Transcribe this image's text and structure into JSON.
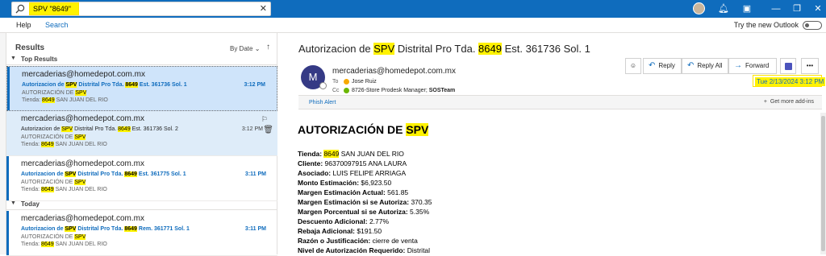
{
  "titlebar": {
    "search_value": "SPV \"8649\"",
    "icons": [
      "search-icon",
      "clear-icon",
      "avatar",
      "bell-icon",
      "settings-icon",
      "minimize-icon",
      "restore-icon",
      "close-icon"
    ],
    "color": "#0f6cbd"
  },
  "ribbon": {
    "tabs": [
      "Help",
      "Search"
    ],
    "new_outlook_label": "Try the new Outlook"
  },
  "list": {
    "title": "Results",
    "sort_label": "By Date",
    "groups": [
      {
        "label": "Top Results"
      },
      {
        "label": "Today"
      }
    ],
    "items": [
      {
        "from": "mercaderias@homedepot.com.mx",
        "subj_pre": "Autorizacion de ",
        "subj_hl1": "SPV",
        "subj_mid": " Distrital Pro Tda. ",
        "subj_hl2": "8649",
        "subj_post": " Est. 361736 Sol. 1",
        "time": "3:12 PM",
        "l3_pre": "AUTORIZACIÓN DE ",
        "l3_hl": "SPV",
        "l4_pre": "Tienda: ",
        "l4_hl": "8649",
        "l4_post": " SAN JUAN DEL RIO"
      },
      {
        "from": "mercaderias@homedepot.com.mx",
        "subj_pre": "Autorizacion de ",
        "subj_hl1": "SPV",
        "subj_mid": " Distrital Pro Tda. ",
        "subj_hl2": "8649",
        "subj_post": " Est. 361736 Sol. 2",
        "time": "3:12 PM",
        "l3_pre": "AUTORIZACIÓN DE ",
        "l3_hl": "SPV",
        "l4_pre": "Tienda: ",
        "l4_hl": "8649",
        "l4_post": " SAN JUAN DEL RIO"
      },
      {
        "from": "mercaderias@homedepot.com.mx",
        "subj_pre": "Autorizacion de ",
        "subj_hl1": "SPV",
        "subj_mid": " Distrital Pro Tda. ",
        "subj_hl2": "8649",
        "subj_post": " Est. 361775 Sol. 1",
        "time": "3:11 PM",
        "l3_pre": "AUTORIZACIÓN DE ",
        "l3_hl": "SPV",
        "l4_pre": "Tienda: ",
        "l4_hl": "8649",
        "l4_post": " SAN JUAN DEL RIO"
      },
      {
        "from": "mercaderias@homedepot.com.mx",
        "subj_pre": "Autorizacion de ",
        "subj_hl1": "SPV",
        "subj_mid": " Distrital Pro Tda. ",
        "subj_hl2": "8649",
        "subj_post": " Rem. 361771 Sol. 1",
        "time": "3:11 PM",
        "l3_pre": "AUTORIZACIÓN DE ",
        "l3_hl": "SPV",
        "l4_pre": "Tienda: ",
        "l4_hl": "8649",
        "l4_post": " SAN JUAN DEL RIO"
      }
    ]
  },
  "reading": {
    "subject_pre": "Autorizacion de ",
    "subject_hl1": "SPV",
    "subject_mid": " Distrital Pro Tda. ",
    "subject_hl2": "8649",
    "subject_post": " Est. 361736 Sol. 1",
    "avatar_letter": "M",
    "sender": "mercaderias@homedepot.com.mx",
    "to_label": "To",
    "to_value": "Jose Ruiz",
    "cc_label": "Cc",
    "cc_value": "8726-Store Prodesk Manager;",
    "cc_value2": "SOSTeam",
    "actions": {
      "reply": "Reply",
      "reply_all": "Reply All",
      "forward": "Forward"
    },
    "date": "Tue 2/13/2024 3:12 PM",
    "phish_label": "Phish Alert",
    "addins_label": "Get more add-ins",
    "body": {
      "title_pre": "AUTORIZACIÓN DE ",
      "title_hl": "SPV",
      "lines": [
        {
          "k": "Tienda:",
          "v_hl": "8649",
          "v": " SAN JUAN DEL RIO"
        },
        {
          "k": "Cliente:",
          "v": " 96370097915 ANA LAURA"
        },
        {
          "k": "Asociado:",
          "v": " LUIS FELIPE ARRIAGA"
        },
        {
          "k": "Monto Estimación:",
          "v": " $6,923.50"
        },
        {
          "k": "Margen Estimación Actual:",
          "v": " 561.85"
        },
        {
          "k": "Margen Estimación si se Autoriza:",
          "v": " 370.35"
        },
        {
          "k": "Margen Porcentual si se Autoriza:",
          "v": " 5.35%"
        },
        {
          "k": "Descuento Adicional:",
          "v": " 2.77%"
        },
        {
          "k": "Rebaja Adicional:",
          "v": " $191.50"
        },
        {
          "k": "Razón o Justificación:",
          "v": " cierre de venta"
        },
        {
          "k": "Nivel de Autorización Requerido:",
          "v": " Distrital"
        }
      ]
    }
  }
}
